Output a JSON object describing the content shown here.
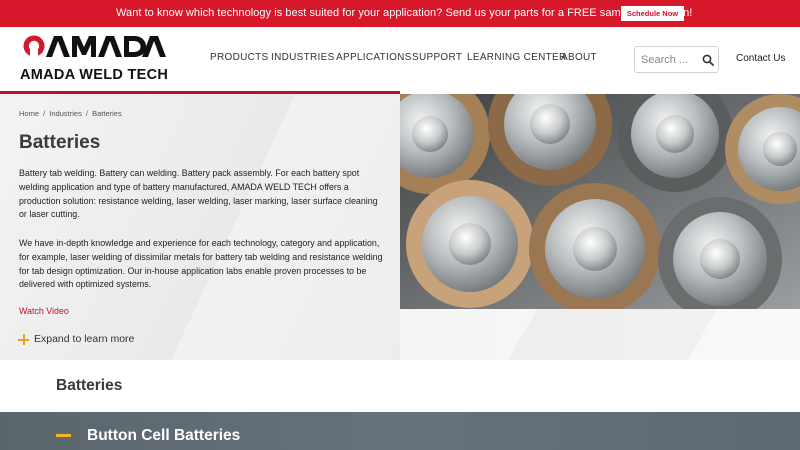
{
  "promo": {
    "message": "Want to know which technology is best suited for your application? Send us your parts for a FREE sample evaluation!",
    "button": "Schedule Now"
  },
  "brand": {
    "logo_text": "AMADA",
    "name": "AMADA WELD TECH"
  },
  "nav": {
    "items": [
      "PRODUCTS",
      "INDUSTRIES",
      "APPLICATIONS",
      "SUPPORT",
      "LEARNING CENTER",
      "ABOUT"
    ]
  },
  "search": {
    "placeholder": "Search ...",
    "icon": "search-icon"
  },
  "contact": "Contact Us",
  "breadcrumb": [
    "Home",
    "/",
    "Industries",
    "/",
    "Batteries"
  ],
  "hero": {
    "title": "Batteries",
    "paragraph1": "Battery tab welding. Battery can welding. Battery pack assembly. For each battery spot welding application and type of battery manufactured, AMADA WELD TECH offers a production solution: resistance welding, laser welding, laser marking, laser surface cleaning or laser cutting.",
    "paragraph2": "We have in-depth knowledge and experience for each technology, category and application, for example, laser welding of dissimilar metals for battery tab welding and resistance welding for tab design optimization. Our in-house application labs enable proven processes to be delivered with optimized systems.",
    "watch_video": "Watch Video",
    "expand": "Expand to learn more"
  },
  "section": {
    "title": "Batteries"
  },
  "accordion": {
    "title": "Button Cell Batteries"
  },
  "colors": {
    "brand_red": "#d7182a",
    "accent_yellow": "#f2b51f",
    "band": "#5f6970"
  }
}
